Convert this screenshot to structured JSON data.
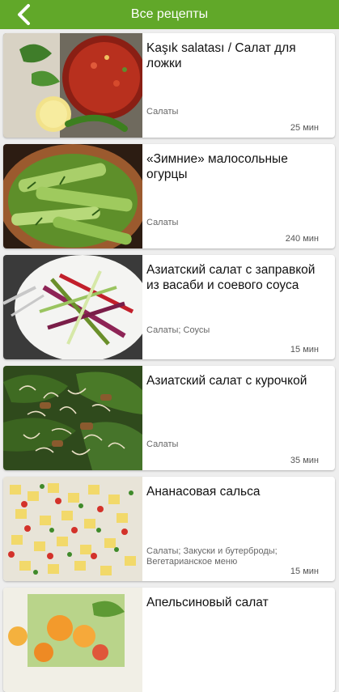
{
  "appbar": {
    "title": "Все рецепты",
    "back_icon": "chevron-left-icon",
    "color": "#61a829"
  },
  "recipes": [
    {
      "title": "Kaşık salatası / Салат для ложки",
      "category": "Салаты",
      "time": "25 мин"
    },
    {
      "title": "«Зимние» малосольные огурцы",
      "category": "Салаты",
      "time": "240 мин"
    },
    {
      "title": "Азиатский салат с заправкой из васаби и соевого соуса",
      "category": "Салаты; Соусы",
      "time": "15 мин"
    },
    {
      "title": "Азиатский салат с курочкой",
      "category": "Салаты",
      "time": "35 мин"
    },
    {
      "title": "Ананасовая сальса",
      "category": "Салаты; Закуски и бутерброды; Вегетарианское меню",
      "time": "15 мин"
    },
    {
      "title": "Апельсиновый салат",
      "category": "",
      "time": ""
    }
  ]
}
